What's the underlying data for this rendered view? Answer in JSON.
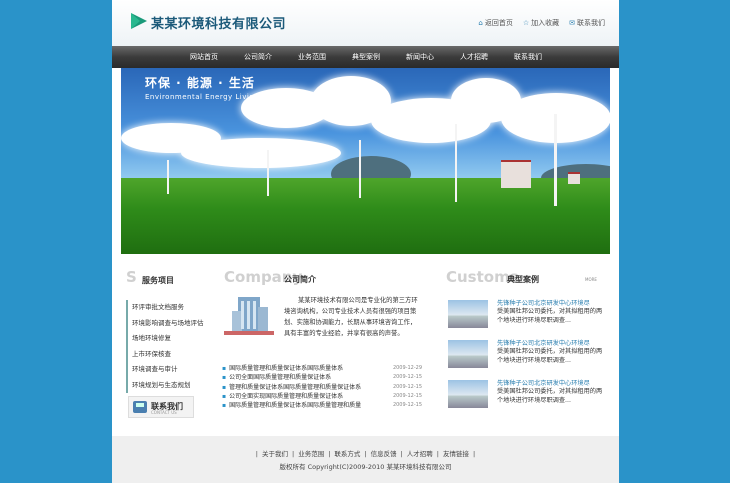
{
  "header": {
    "company": "某某环境科技有限公司",
    "links": [
      {
        "icon": "home-icon",
        "label": "返回首页"
      },
      {
        "icon": "star-icon",
        "label": "加入收藏"
      },
      {
        "icon": "mail-icon",
        "label": "联系我们"
      }
    ]
  },
  "nav": [
    "网站首页",
    "公司简介",
    "业务范围",
    "典型案例",
    "新闻中心",
    "人才招聘",
    "联系我们"
  ],
  "banner": {
    "slogan": "环保 · 能源 · 生活",
    "slogan_en": "Environmental  Energy  Living"
  },
  "services": {
    "letter": "S",
    "title": "服务项目",
    "items": [
      "环评审批文档服务",
      "环境影响调查与场地评估",
      "场地环境修复",
      "上市环保核查",
      "环境调查与审计",
      "环境规划与生态规划"
    ],
    "contact_title": "联系我们",
    "contact_sub": "CONTACT US"
  },
  "about": {
    "big": "Company",
    "title": "公司简介",
    "text": "某某环境技术有限公司是专业化的第三方环境咨询机构，公司专业技术人员有很强的项目策划、实施和协调能力，长期从事环境咨询工作，具有丰富的专业经验，并享有很高的声誉。"
  },
  "news": [
    {
      "title": "国际质量管理和质量保证体系国际质量体系",
      "date": "2009-12-29"
    },
    {
      "title": "公司全面国际质量管理和质量保证体系",
      "date": "2009-12-15"
    },
    {
      "title": "管理和质量保证体系国际质量管理和质量保证体系",
      "date": "2009-12-15"
    },
    {
      "title": "公司全面实现国际质量管理和质量保证体系",
      "date": "2009-12-15"
    },
    {
      "title": "国际质量管理和质量保证体系国际质量管理和质量",
      "date": "2009-12-15"
    }
  ],
  "cases": {
    "big": "Customs",
    "title": "典型案例",
    "more": "MORE",
    "items": [
      {
        "title": "先锋种子公司北京研发中心环境尽",
        "desc": "受美国杜邦公司委托，对其拟租用的两个地块进行环境尽职调查..."
      },
      {
        "title": "先锋种子公司北京研发中心环境尽",
        "desc": "受美国杜邦公司委托，对其拟租用的两个地块进行环境尽职调查..."
      },
      {
        "title": "先锋种子公司北京研发中心环境尽",
        "desc": "受美国杜邦公司委托，对其拟租用的两个地块进行环境尽职调查..."
      }
    ]
  },
  "footer": {
    "links": [
      "关于我们",
      "业务范围",
      "联系方式",
      "信息反馈",
      "人才招聘",
      "友情链接"
    ],
    "copyright": "版权所有 Copyright(C)2009-2010 某某环境科技有限公司"
  }
}
